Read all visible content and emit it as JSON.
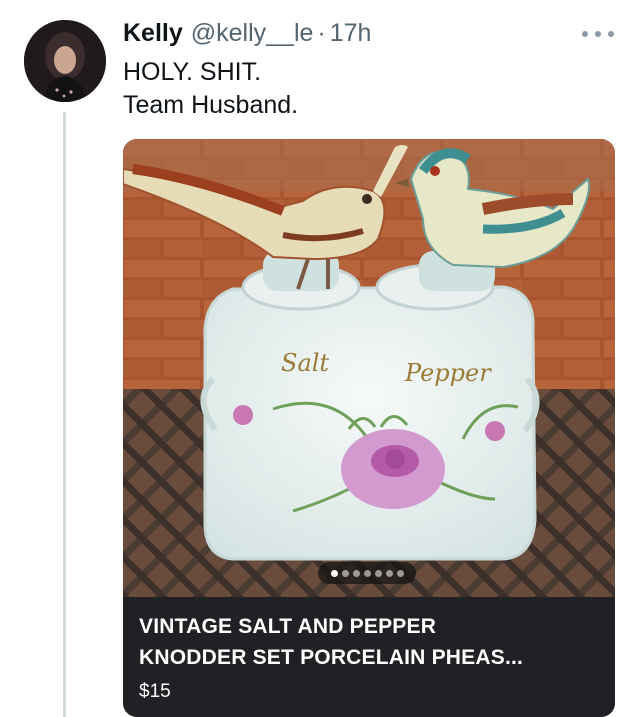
{
  "tweet": {
    "author": {
      "display_name": "Kelly",
      "handle": "@kelly__le",
      "avatar_icon": "user-avatar"
    },
    "separator": "·",
    "timestamp": "17h",
    "more_icon": "more-horizontal-icon",
    "text_lines": [
      "HOLY. SHIT.",
      "Team Husband."
    ]
  },
  "card": {
    "image_text": {
      "salt_label": "Salt",
      "pepper_label": "Pepper"
    },
    "carousel": {
      "count": 7,
      "active_index": 0
    },
    "product_title_line1": "VINTAGE SALT AND PEPPER",
    "product_title_line2": "KNODDER SET PORCELAIN PHEAS...",
    "price": "$15"
  },
  "colors": {
    "text_primary": "#0f1419",
    "text_secondary": "#536471",
    "thread_line": "#cfd9de",
    "card_footer": "#202124"
  }
}
